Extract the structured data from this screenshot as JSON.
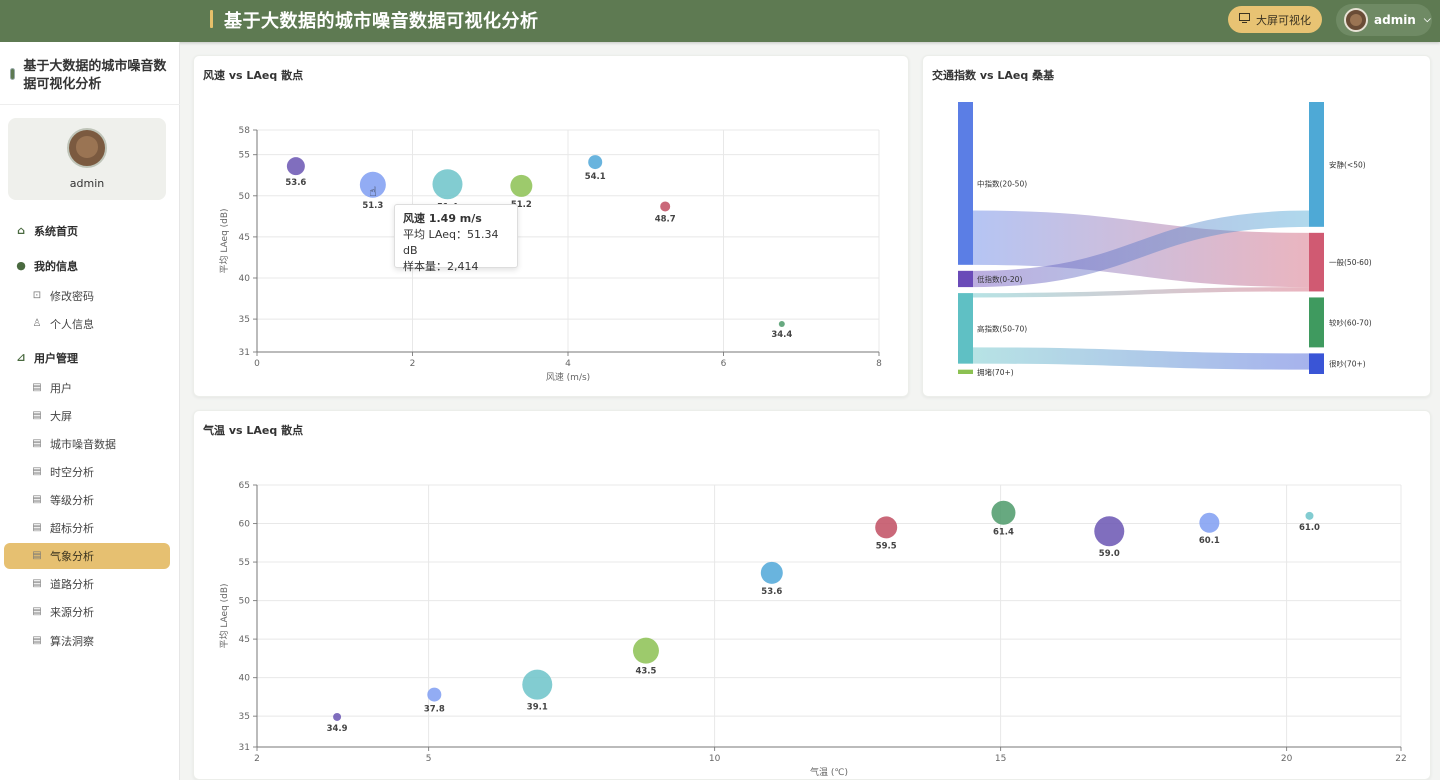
{
  "header": {
    "title": "基于大数据的城市噪音数据可视化分析",
    "bigscreen_label": "大屏可视化",
    "user": "admin",
    "bigscreen_icon": "monitor-icon",
    "user_caret": "chevron-down-icon"
  },
  "sidebar": {
    "brand": "基于大数据的城市噪音数据可视化分析",
    "user_name": "admin",
    "items": [
      {
        "label": "系统首页",
        "icon": "home-icon",
        "level": "top"
      },
      {
        "label": "我的信息",
        "icon": "user-icon",
        "level": "top"
      },
      {
        "label": "修改密码",
        "icon": "lock-icon",
        "level": "sub"
      },
      {
        "label": "个人信息",
        "icon": "person-icon",
        "level": "sub"
      },
      {
        "label": "用户管理",
        "icon": "chart-icon",
        "level": "top"
      },
      {
        "label": "用户",
        "icon": "doc-icon",
        "level": "sub"
      },
      {
        "label": "大屏",
        "icon": "doc-icon",
        "level": "sub"
      },
      {
        "label": "城市噪音数据",
        "icon": "doc-icon",
        "level": "sub"
      },
      {
        "label": "时空分析",
        "icon": "doc-icon",
        "level": "sub"
      },
      {
        "label": "等级分析",
        "icon": "doc-icon",
        "level": "sub"
      },
      {
        "label": "超标分析",
        "icon": "doc-icon",
        "level": "sub"
      },
      {
        "label": "气象分析",
        "icon": "doc-icon",
        "level": "sub",
        "active": true
      },
      {
        "label": "道路分析",
        "icon": "doc-icon",
        "level": "sub"
      },
      {
        "label": "来源分析",
        "icon": "doc-icon",
        "level": "sub"
      },
      {
        "label": "算法洞察",
        "icon": "doc-icon",
        "level": "sub"
      }
    ]
  },
  "chart_data": [
    {
      "type": "scatter",
      "title": "风速 vs LAeq 散点",
      "xlabel": "风速 (m/s)",
      "ylabel": "平均 LAeq (dB)",
      "xlim": [
        0,
        8
      ],
      "ylim": [
        31,
        58
      ],
      "xticks": [
        0,
        2,
        4,
        6,
        8
      ],
      "yticks": [
        31,
        35,
        40,
        45,
        50,
        55,
        58
      ],
      "points": [
        {
          "x": 0.5,
          "y": 53.6,
          "label": "53.6",
          "size": 9,
          "color": "#6a55b3"
        },
        {
          "x": 1.49,
          "y": 51.34,
          "label": "51.3",
          "size": 13,
          "color": "#7f9ef2"
        },
        {
          "x": 2.45,
          "y": 51.4,
          "label": "51.4",
          "size": 15,
          "color": "#6cc3c9"
        },
        {
          "x": 3.4,
          "y": 51.2,
          "label": "51.2",
          "size": 11,
          "color": "#8cc152"
        },
        {
          "x": 4.35,
          "y": 54.1,
          "label": "54.1",
          "size": 7,
          "color": "#4fa7d8"
        },
        {
          "x": 5.25,
          "y": 48.7,
          "label": "48.7",
          "size": 5,
          "color": "#c14e62"
        },
        {
          "x": 6.75,
          "y": 34.4,
          "label": "34.4",
          "size": 3,
          "color": "#4c9a6a"
        }
      ],
      "tooltip": {
        "title": "风速 1.49 m/s",
        "line1": "平均 LAeq：51.34 dB",
        "line2": "样本量：2,414"
      }
    },
    {
      "type": "sankey",
      "title": "交通指数 vs LAeq 桑基",
      "sources": [
        {
          "name": "中指数(20-50)",
          "color": "#5b7ee5"
        },
        {
          "name": "低指数(0-20)",
          "color": "#6a4bb8"
        },
        {
          "name": "高指数(50-70)",
          "color": "#5fc0c4"
        },
        {
          "name": "拥堵(70+)",
          "color": "#8cc152"
        }
      ],
      "targets": [
        {
          "name": "安静(<50)",
          "color": "#4ea9d6"
        },
        {
          "name": "一般(50-60)",
          "color": "#d05a72"
        },
        {
          "name": "较吵(60-70)",
          "color": "#3f9a5f"
        },
        {
          "name": "很吵(70+)",
          "color": "#3a55d6"
        }
      ],
      "links": [
        {
          "source": "中指数(20-50)",
          "target": "安静(<50)",
          "value": 1000
        },
        {
          "source": "中指数(20-50)",
          "target": "一般(50-60)",
          "value": 500
        },
        {
          "source": "低指数(0-20)",
          "target": "安静(<50)",
          "value": 150
        },
        {
          "source": "高指数(50-70)",
          "target": "一般(50-60)",
          "value": 40
        },
        {
          "source": "高指数(50-70)",
          "target": "较吵(60-70)",
          "value": 460
        },
        {
          "source": "高指数(50-70)",
          "target": "很吵(70+)",
          "value": 150
        },
        {
          "source": "拥堵(70+)",
          "target": "很吵(70+)",
          "value": 40
        }
      ]
    },
    {
      "type": "scatter",
      "title": "气温 vs LAeq 散点",
      "xlabel": "气温 (℃)",
      "ylabel": "平均 LAeq (dB)",
      "xlim": [
        2,
        22
      ],
      "ylim": [
        31,
        65
      ],
      "xticks": [
        2,
        5,
        10,
        15,
        20,
        22
      ],
      "yticks": [
        31,
        35,
        40,
        45,
        50,
        55,
        60,
        65
      ],
      "points": [
        {
          "x": 3.4,
          "y": 34.9,
          "label": "34.9",
          "size": 4,
          "color": "#6a55b3"
        },
        {
          "x": 5.1,
          "y": 37.8,
          "label": "37.8",
          "size": 7,
          "color": "#7f9ef2"
        },
        {
          "x": 6.9,
          "y": 39.1,
          "label": "39.1",
          "size": 15,
          "color": "#6cc3c9"
        },
        {
          "x": 8.8,
          "y": 43.5,
          "label": "43.5",
          "size": 13,
          "color": "#8cc152"
        },
        {
          "x": 11.0,
          "y": 53.6,
          "label": "53.6",
          "size": 11,
          "color": "#4fa7d8"
        },
        {
          "x": 13.0,
          "y": 59.5,
          "label": "59.5",
          "size": 11,
          "color": "#c14e62"
        },
        {
          "x": 15.05,
          "y": 61.4,
          "label": "61.4",
          "size": 12,
          "color": "#4c9a6a"
        },
        {
          "x": 16.9,
          "y": 59.0,
          "label": "59.0",
          "size": 15,
          "color": "#6a55b3"
        },
        {
          "x": 18.65,
          "y": 60.1,
          "label": "60.1",
          "size": 10,
          "color": "#7f9ef2"
        },
        {
          "x": 20.4,
          "y": 61.0,
          "label": "61.0",
          "size": 4,
          "color": "#6cc3c9"
        }
      ]
    }
  ]
}
